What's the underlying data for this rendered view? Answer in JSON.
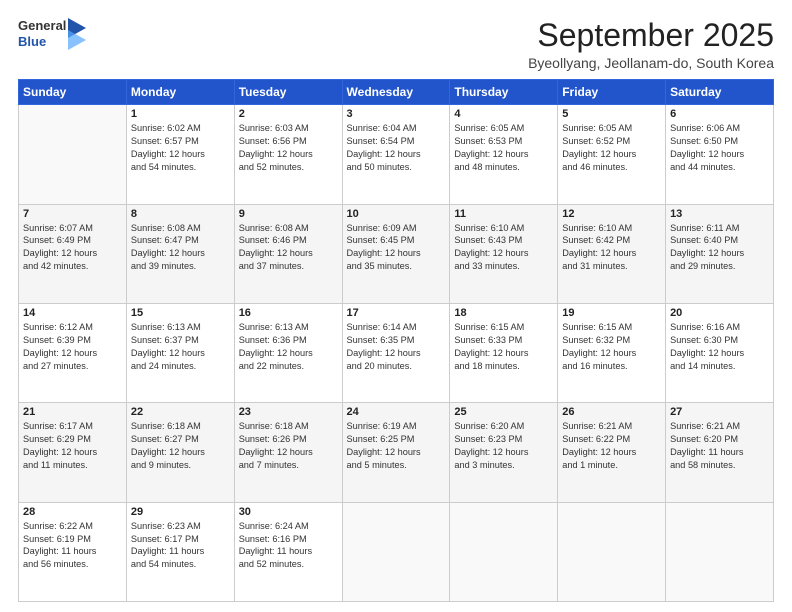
{
  "header": {
    "logo_general": "General",
    "logo_blue": "Blue",
    "month": "September 2025",
    "location": "Byeollyang, Jeollanam-do, South Korea"
  },
  "days_of_week": [
    "Sunday",
    "Monday",
    "Tuesday",
    "Wednesday",
    "Thursday",
    "Friday",
    "Saturday"
  ],
  "weeks": [
    [
      {
        "day": "",
        "info": ""
      },
      {
        "day": "1",
        "info": "Sunrise: 6:02 AM\nSunset: 6:57 PM\nDaylight: 12 hours\nand 54 minutes."
      },
      {
        "day": "2",
        "info": "Sunrise: 6:03 AM\nSunset: 6:56 PM\nDaylight: 12 hours\nand 52 minutes."
      },
      {
        "day": "3",
        "info": "Sunrise: 6:04 AM\nSunset: 6:54 PM\nDaylight: 12 hours\nand 50 minutes."
      },
      {
        "day": "4",
        "info": "Sunrise: 6:05 AM\nSunset: 6:53 PM\nDaylight: 12 hours\nand 48 minutes."
      },
      {
        "day": "5",
        "info": "Sunrise: 6:05 AM\nSunset: 6:52 PM\nDaylight: 12 hours\nand 46 minutes."
      },
      {
        "day": "6",
        "info": "Sunrise: 6:06 AM\nSunset: 6:50 PM\nDaylight: 12 hours\nand 44 minutes."
      }
    ],
    [
      {
        "day": "7",
        "info": "Sunrise: 6:07 AM\nSunset: 6:49 PM\nDaylight: 12 hours\nand 42 minutes."
      },
      {
        "day": "8",
        "info": "Sunrise: 6:08 AM\nSunset: 6:47 PM\nDaylight: 12 hours\nand 39 minutes."
      },
      {
        "day": "9",
        "info": "Sunrise: 6:08 AM\nSunset: 6:46 PM\nDaylight: 12 hours\nand 37 minutes."
      },
      {
        "day": "10",
        "info": "Sunrise: 6:09 AM\nSunset: 6:45 PM\nDaylight: 12 hours\nand 35 minutes."
      },
      {
        "day": "11",
        "info": "Sunrise: 6:10 AM\nSunset: 6:43 PM\nDaylight: 12 hours\nand 33 minutes."
      },
      {
        "day": "12",
        "info": "Sunrise: 6:10 AM\nSunset: 6:42 PM\nDaylight: 12 hours\nand 31 minutes."
      },
      {
        "day": "13",
        "info": "Sunrise: 6:11 AM\nSunset: 6:40 PM\nDaylight: 12 hours\nand 29 minutes."
      }
    ],
    [
      {
        "day": "14",
        "info": "Sunrise: 6:12 AM\nSunset: 6:39 PM\nDaylight: 12 hours\nand 27 minutes."
      },
      {
        "day": "15",
        "info": "Sunrise: 6:13 AM\nSunset: 6:37 PM\nDaylight: 12 hours\nand 24 minutes."
      },
      {
        "day": "16",
        "info": "Sunrise: 6:13 AM\nSunset: 6:36 PM\nDaylight: 12 hours\nand 22 minutes."
      },
      {
        "day": "17",
        "info": "Sunrise: 6:14 AM\nSunset: 6:35 PM\nDaylight: 12 hours\nand 20 minutes."
      },
      {
        "day": "18",
        "info": "Sunrise: 6:15 AM\nSunset: 6:33 PM\nDaylight: 12 hours\nand 18 minutes."
      },
      {
        "day": "19",
        "info": "Sunrise: 6:15 AM\nSunset: 6:32 PM\nDaylight: 12 hours\nand 16 minutes."
      },
      {
        "day": "20",
        "info": "Sunrise: 6:16 AM\nSunset: 6:30 PM\nDaylight: 12 hours\nand 14 minutes."
      }
    ],
    [
      {
        "day": "21",
        "info": "Sunrise: 6:17 AM\nSunset: 6:29 PM\nDaylight: 12 hours\nand 11 minutes."
      },
      {
        "day": "22",
        "info": "Sunrise: 6:18 AM\nSunset: 6:27 PM\nDaylight: 12 hours\nand 9 minutes."
      },
      {
        "day": "23",
        "info": "Sunrise: 6:18 AM\nSunset: 6:26 PM\nDaylight: 12 hours\nand 7 minutes."
      },
      {
        "day": "24",
        "info": "Sunrise: 6:19 AM\nSunset: 6:25 PM\nDaylight: 12 hours\nand 5 minutes."
      },
      {
        "day": "25",
        "info": "Sunrise: 6:20 AM\nSunset: 6:23 PM\nDaylight: 12 hours\nand 3 minutes."
      },
      {
        "day": "26",
        "info": "Sunrise: 6:21 AM\nSunset: 6:22 PM\nDaylight: 12 hours\nand 1 minute."
      },
      {
        "day": "27",
        "info": "Sunrise: 6:21 AM\nSunset: 6:20 PM\nDaylight: 11 hours\nand 58 minutes."
      }
    ],
    [
      {
        "day": "28",
        "info": "Sunrise: 6:22 AM\nSunset: 6:19 PM\nDaylight: 11 hours\nand 56 minutes."
      },
      {
        "day": "29",
        "info": "Sunrise: 6:23 AM\nSunset: 6:17 PM\nDaylight: 11 hours\nand 54 minutes."
      },
      {
        "day": "30",
        "info": "Sunrise: 6:24 AM\nSunset: 6:16 PM\nDaylight: 11 hours\nand 52 minutes."
      },
      {
        "day": "",
        "info": ""
      },
      {
        "day": "",
        "info": ""
      },
      {
        "day": "",
        "info": ""
      },
      {
        "day": "",
        "info": ""
      }
    ]
  ]
}
